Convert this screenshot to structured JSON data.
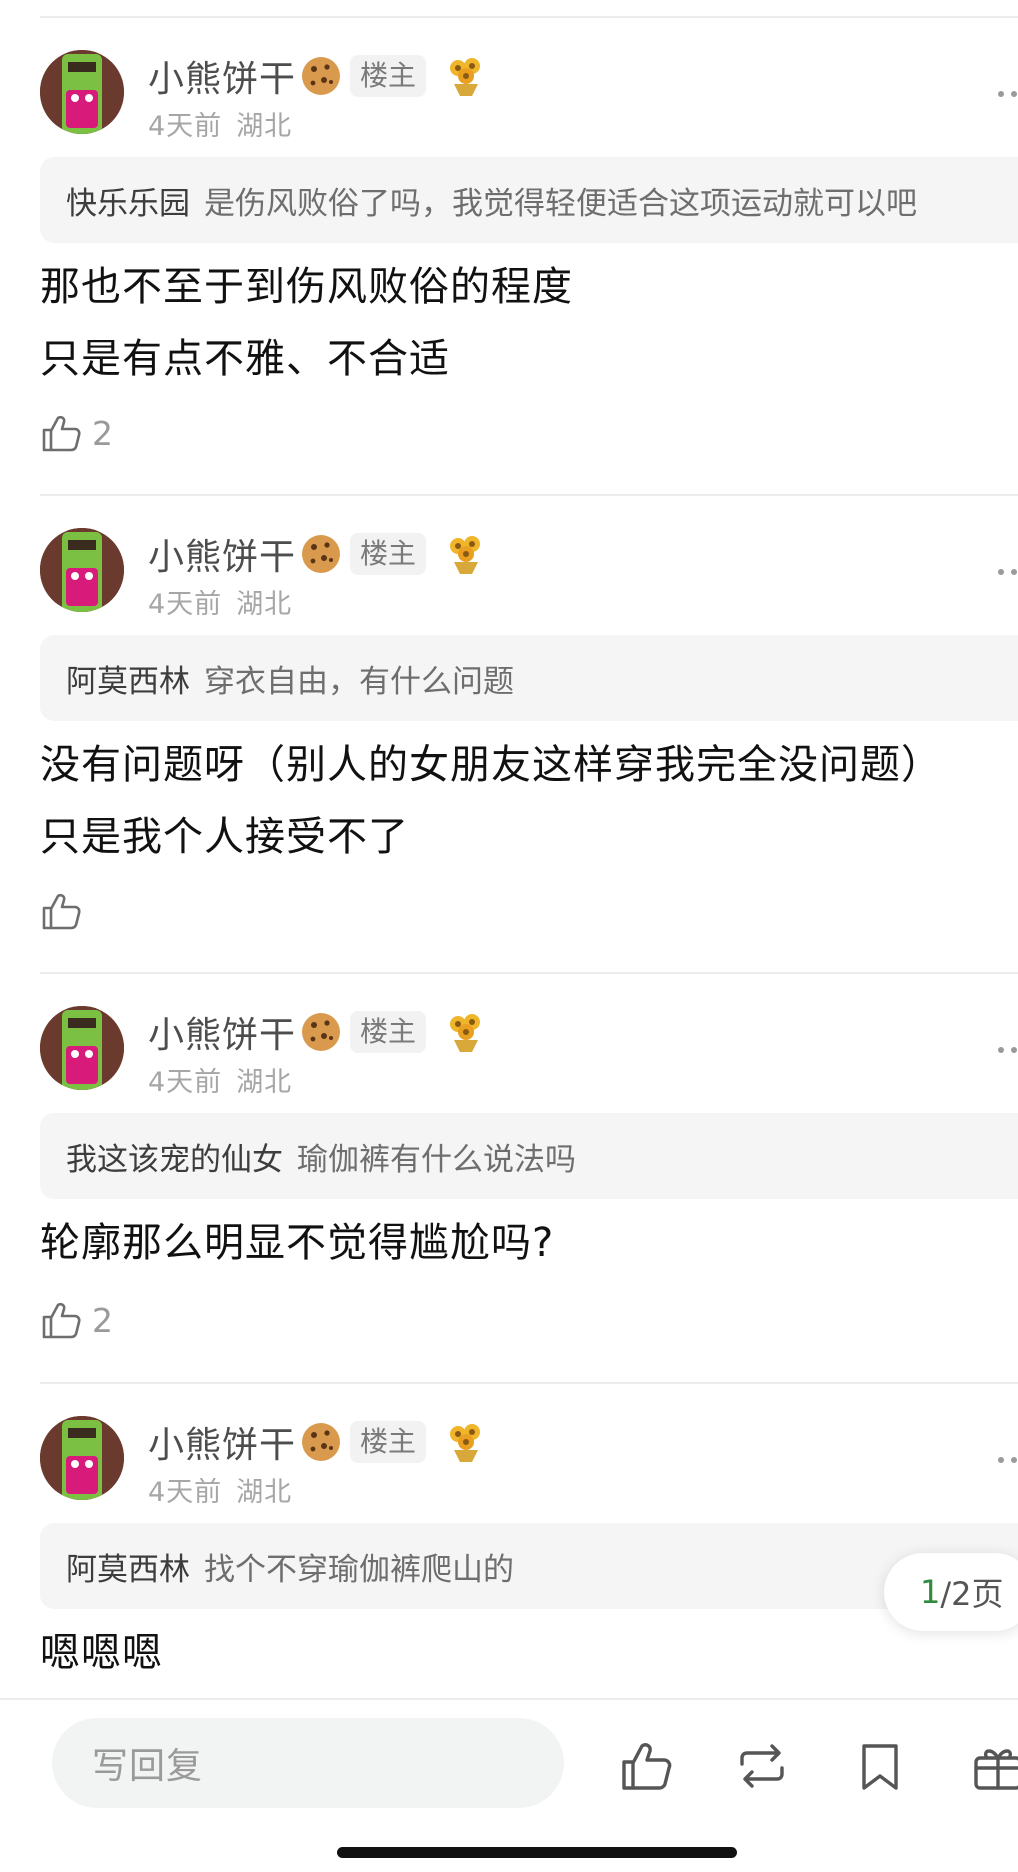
{
  "comments": [
    {
      "author": "小熊饼干",
      "badge": "楼主",
      "time": "4天前",
      "location": "湖北",
      "quote_author": "快乐乐园",
      "quote_text": "是伤风败俗了吗，我觉得轻便适合这项运动就可以吧",
      "lines": [
        "那也不至于到伤风败俗的程度",
        "只是有点不雅、不合适"
      ],
      "likes": "2"
    },
    {
      "author": "小熊饼干",
      "badge": "楼主",
      "time": "4天前",
      "location": "湖北",
      "quote_author": "阿莫西林",
      "quote_text": "穿衣自由，有什么问题",
      "lines": [
        "没有问题呀（别人的女朋友这样穿我完全没问题）",
        "只是我个人接受不了"
      ],
      "likes": ""
    },
    {
      "author": "小熊饼干",
      "badge": "楼主",
      "time": "4天前",
      "location": "湖北",
      "quote_author": "我这该宠的仙女",
      "quote_text": "瑜伽裤有什么说法吗",
      "lines": [
        "轮廓那么明显不觉得尴尬吗?"
      ],
      "likes": "2"
    },
    {
      "author": "小熊饼干",
      "badge": "楼主",
      "time": "4天前",
      "location": "湖北",
      "quote_author": "阿莫西林",
      "quote_text": "找个不穿瑜伽裤爬山的",
      "lines": [
        "嗯嗯嗯"
      ],
      "likes": null
    }
  ],
  "pager": {
    "current": "1",
    "total_suffix": "/2页"
  },
  "bottom_bar": {
    "reply_placeholder": "写回复"
  },
  "icons": {
    "like": "thumbs-up-icon",
    "share": "repost-icon",
    "bookmark": "bookmark-icon",
    "gift": "gift-icon",
    "more": "more-dots-icon",
    "cookie": "cookie-emoji-icon",
    "flower": "sunflower-icon"
  },
  "colors": {
    "accent": "#2e8b3f",
    "quote_bg": "#f5f5f5"
  }
}
